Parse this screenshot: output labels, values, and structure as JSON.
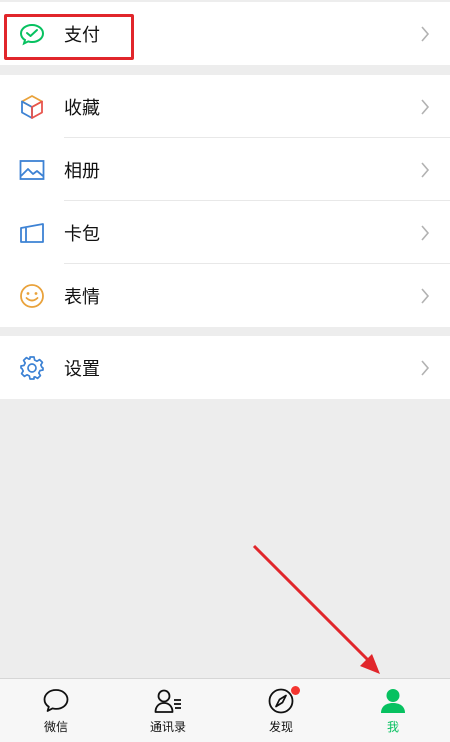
{
  "menu": {
    "pay": {
      "label": "支付"
    },
    "favorites": {
      "label": "收藏"
    },
    "album": {
      "label": "相册"
    },
    "cards": {
      "label": "卡包"
    },
    "stickers": {
      "label": "表情"
    },
    "settings": {
      "label": "设置"
    }
  },
  "tabbar": {
    "chats": "微信",
    "contacts": "通讯录",
    "discover": "发现",
    "me": "我"
  },
  "colors": {
    "accent_green": "#07c160",
    "annotation_red": "#e1262b",
    "badge_red": "#f43530"
  }
}
